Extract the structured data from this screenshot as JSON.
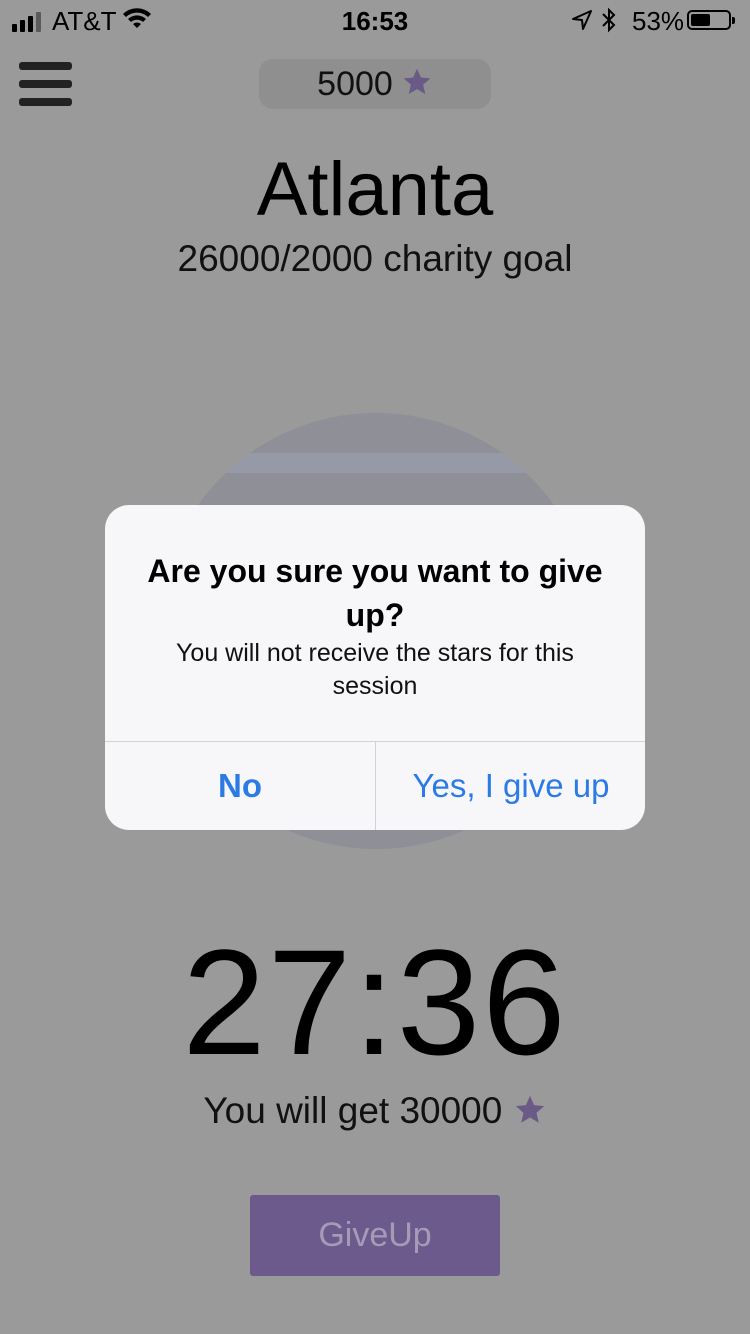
{
  "status_bar": {
    "carrier": "AT&T",
    "time": "16:53",
    "battery_percent": "53%",
    "battery_level": 0.53,
    "icons": [
      "signal-icon",
      "wifi-icon",
      "location-icon",
      "bluetooth-icon",
      "battery-icon"
    ]
  },
  "header": {
    "menu_icon": "hamburger-menu-icon",
    "star_count": "5000",
    "star_icon": "★"
  },
  "main": {
    "city": "Atlanta",
    "goal_text": "26000/2000 charity goal",
    "timer": "27:36",
    "reward_text": "You will get 30000",
    "reward_star": "★",
    "giveup_label": "GiveUp"
  },
  "alert": {
    "title": "Are you sure you want to give up?",
    "message": "You will not receive the stars for this session",
    "no_label": "No",
    "yes_label": "Yes, I give up"
  },
  "colors": {
    "background_dimmed": "#9a9a9a",
    "accent_purple": "#6c5a8c",
    "alert_button_blue": "#2c7be5"
  }
}
